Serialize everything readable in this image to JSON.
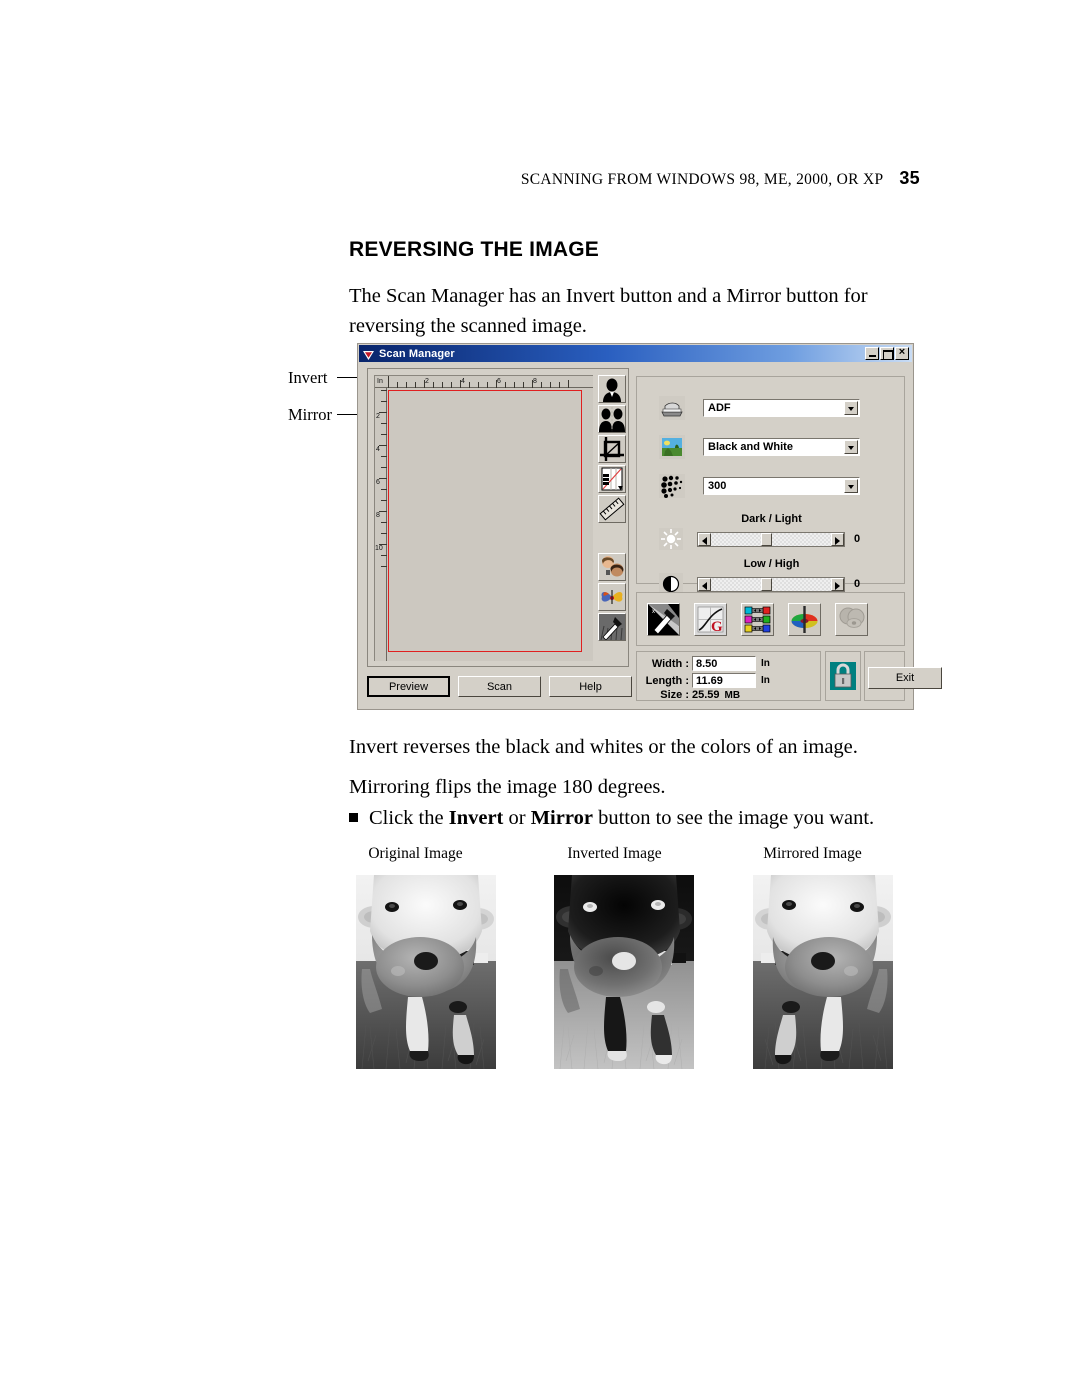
{
  "page": {
    "running_head": "SCANNING FROM WINDOWS 98, ME, 2000, OR XP",
    "page_number": "35",
    "section_heading": "REVERSING THE IMAGE",
    "intro_paragraph": "The Scan Manager has an Invert button and a Mirror button for reversing the scanned image.",
    "invert_paragraph": "Invert reverses the black and whites or the colors of an image.",
    "mirror_paragraph": "Mirroring flips the image 180 degrees.",
    "bullet": {
      "lead": "Click the ",
      "bold1": "Invert",
      "mid": " or ",
      "bold2": "Mirror",
      "tail": " button to see the image you want."
    }
  },
  "callouts": {
    "invert": "Invert",
    "mirror": "Mirror"
  },
  "scan_manager": {
    "title": "Scan Manager",
    "window_buttons": {
      "minimize": "minimize-icon",
      "maximize": "maximize-icon",
      "close": "close-icon"
    },
    "ruler": {
      "unit_label": "In",
      "horizontal_labels": [
        "2",
        "4",
        "6",
        "8"
      ],
      "vertical_labels": [
        "2",
        "4",
        "6",
        "8",
        "10"
      ]
    },
    "tools": [
      {
        "name": "invert-tool",
        "icon": "portrait-silhouette-icon"
      },
      {
        "name": "mirror-tool",
        "icon": "mirrored-silhouette-icon"
      },
      {
        "name": "crop-tool",
        "icon": "crop-frame-icon"
      },
      {
        "name": "paper-size-tool",
        "icon": "paper-sizes-icon"
      },
      {
        "name": "measure-tool",
        "icon": "ruler-icon"
      },
      {
        "name": "compare-tool",
        "icon": "two-faces-icon"
      },
      {
        "name": "color-adjust-tool",
        "icon": "butterfly-icon"
      },
      {
        "name": "eyedropper-tool",
        "icon": "eyedropper-icon"
      }
    ],
    "settings": [
      {
        "name": "source",
        "icon": "scanner-icon",
        "value": "ADF"
      },
      {
        "name": "color-mode",
        "icon": "landscape-photo-icon",
        "value": "Black and White"
      },
      {
        "name": "resolution",
        "icon": "halftone-dots-icon",
        "value": "300"
      }
    ],
    "sliders": [
      {
        "name": "dark-light",
        "label": "Dark / Light",
        "icon": "brightness-sun-icon",
        "value": "0"
      },
      {
        "name": "low-high",
        "label": "Low / High",
        "icon": "contrast-circle-icon",
        "value": "0"
      }
    ],
    "icon_row": [
      {
        "name": "auto-level-button",
        "icon": "brush-gradient-icon"
      },
      {
        "name": "gamma-curve-button",
        "icon": "curve-g-icon"
      },
      {
        "name": "color-balance-button",
        "icon": "cmy-rgb-sliders-icon"
      },
      {
        "name": "hue-saturation-button",
        "icon": "color-wheel-icon"
      },
      {
        "name": "preview-effect-button",
        "icon": "grayed-eye-icon"
      }
    ],
    "dimensions": {
      "width_label": "Width :",
      "width_value": "8.50",
      "width_unit": "In",
      "length_label": "Length :",
      "length_value": "11.69",
      "length_unit": "In",
      "size_label": "Size :",
      "size_value": "25.59",
      "size_unit": "MB",
      "lock_icon": "padlock-icon"
    },
    "buttons": {
      "preview": "Preview",
      "scan": "Scan",
      "help": "Help",
      "exit": "Exit"
    }
  },
  "figures": [
    {
      "caption": "Original Image",
      "name": "original-cow-photo"
    },
    {
      "caption": "Inverted Image",
      "name": "inverted-cow-photo"
    },
    {
      "caption": "Mirrored Image",
      "name": "mirrored-cow-photo"
    }
  ]
}
